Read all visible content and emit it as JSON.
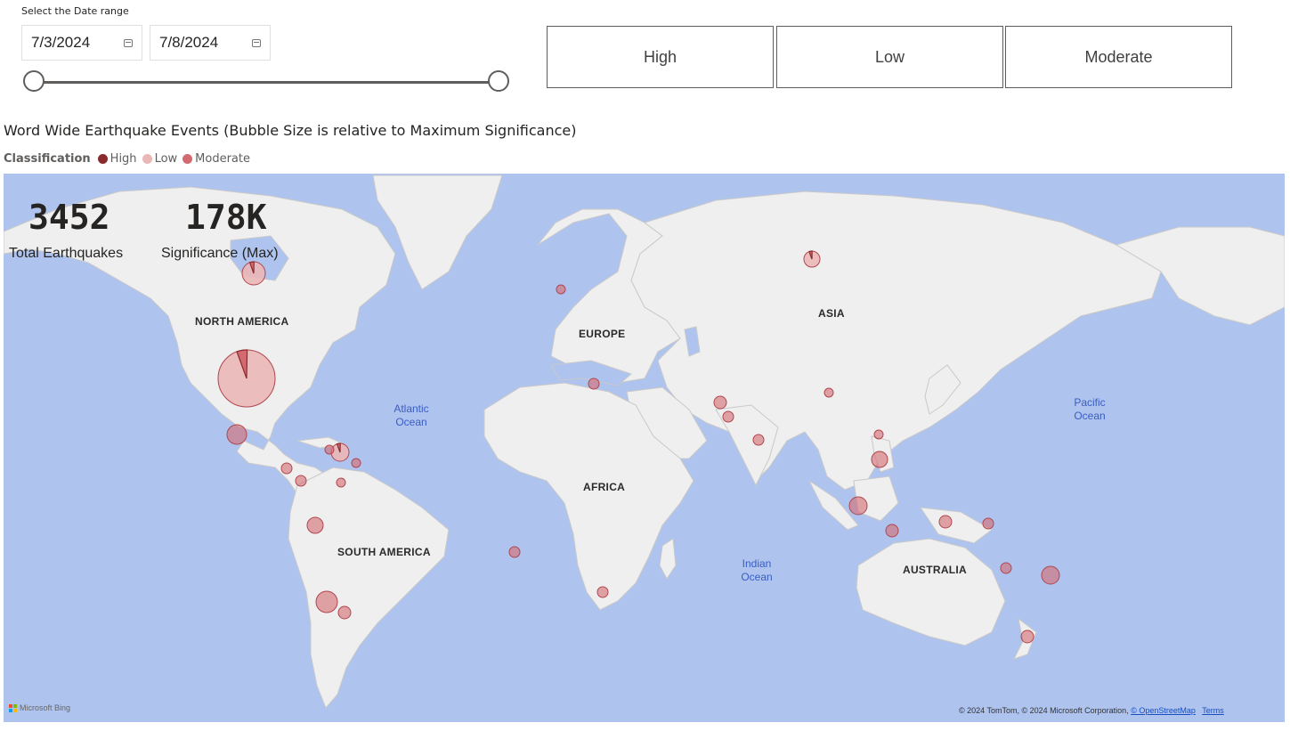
{
  "filters": {
    "date_range_label": "Select the Date range",
    "start_date": "7/3/2024",
    "end_date": "7/8/2024",
    "calendar_icon": "calendar-icon"
  },
  "classification_buttons": {
    "high": "High",
    "low": "Low",
    "moderate": "Moderate"
  },
  "chart": {
    "title": "Word Wide Earthquake Events (Bubble Size is relative to Maximum Significance)",
    "legend_title": "Classification",
    "legend": [
      {
        "label": "High",
        "color": "#8b2a2e"
      },
      {
        "label": "Low",
        "color": "#eab7b7"
      },
      {
        "label": "Moderate",
        "color": "#d36a70"
      }
    ]
  },
  "kpis": {
    "total_earthquakes_value": "3452",
    "total_earthquakes_label": "Total Earthquakes",
    "significance_value": "178K",
    "significance_label": "Significance (Max)"
  },
  "map_labels": {
    "north_america": "NORTH AMERICA",
    "europe": "EUROPE",
    "asia": "ASIA",
    "africa": "AFRICA",
    "south_america": "SOUTH AMERICA",
    "australia": "AUSTRALIA",
    "atlantic_1": "Atlantic",
    "atlantic_2": "Ocean",
    "pacific_1": "Pacific",
    "pacific_2": "Ocean",
    "indian_1": "Indian",
    "indian_2": "Ocean"
  },
  "attribution": {
    "brand": "Microsoft Bing",
    "text": "© 2024 TomTom, © 2024 Microsoft Corporation,",
    "osm_link": "© OpenStreetMap",
    "terms_link": "Terms"
  },
  "colors": {
    "ocean": "#aec3ee",
    "land": "#efefef",
    "bubble_moderate": "#d36a70",
    "bubble_low": "#eab7b7",
    "bubble_high": "#8b2a2e"
  }
}
